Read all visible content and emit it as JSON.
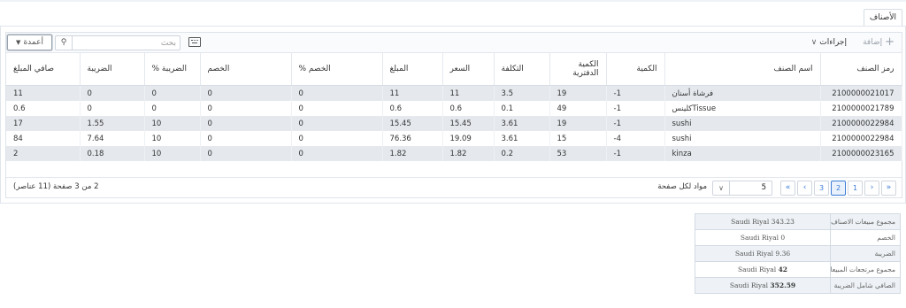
{
  "tab": {
    "label": "الأصناف"
  },
  "toolbar": {
    "add_label": "إضافة",
    "actions_label": "إجراءات",
    "search_placeholder": "بحث",
    "columns_label": "أعمدة"
  },
  "table": {
    "headers": [
      "رمز الصنف",
      "اسم الصنف",
      "الكمية",
      "الكمية الدفترية",
      "التكلفة",
      "السعر",
      "المبلغ",
      "الخصم %",
      "الخصم",
      "الضريبة %",
      "الضريبة",
      "صافي المبلغ"
    ],
    "rows": [
      [
        "2100000021017",
        "فرشاة أسنان",
        "1-",
        "19",
        "3.5",
        "11",
        "11",
        "0",
        "0",
        "0",
        "0",
        "11"
      ],
      [
        "2100000021789",
        "Tissueكلينس",
        "1-",
        "49",
        "0.1",
        "0.6",
        "0.6",
        "0",
        "0",
        "0",
        "0",
        "0.6"
      ],
      [
        "2100000022984",
        "sushi",
        "1-",
        "19",
        "3.61",
        "15.45",
        "15.45",
        "0",
        "0",
        "10",
        "1.55",
        "17"
      ],
      [
        "2100000022984",
        "sushi",
        "4-",
        "15",
        "3.61",
        "19.09",
        "76.36",
        "0",
        "0",
        "10",
        "7.64",
        "84"
      ],
      [
        "2100000023165",
        "kinza",
        "1-",
        "53",
        "0.2",
        "1.82",
        "1.82",
        "0",
        "0",
        "10",
        "0.18",
        "2"
      ]
    ]
  },
  "pager": {
    "first": "«",
    "prev": "‹",
    "pages": [
      "1",
      "2",
      "3"
    ],
    "current_page": "2",
    "next": "›",
    "last": "»",
    "page_size": "5",
    "page_size_label": "مواد لكل صفحة",
    "info": "2 من 3 صفحة (11 عناصر)"
  },
  "totals": {
    "rows": [
      {
        "label": "مجموع مبيعات الاصناف",
        "value": "Saudi Riyal 343.23",
        "bold": false
      },
      {
        "label": "الخصم",
        "value": "Saudi Riyal 0",
        "bold": false
      },
      {
        "label": "الضريبة",
        "value": "Saudi Riyal 9.36",
        "bold": false
      },
      {
        "label": "مجموع مرتجعات المبيعات",
        "value_prefix": "Saudi Riyal",
        "value_bold": "42",
        "bold": true
      },
      {
        "label": "الصافي شامل الضريبة",
        "value_prefix": "Saudi Riyal",
        "value_bold": "352.59",
        "bold": true
      }
    ]
  }
}
